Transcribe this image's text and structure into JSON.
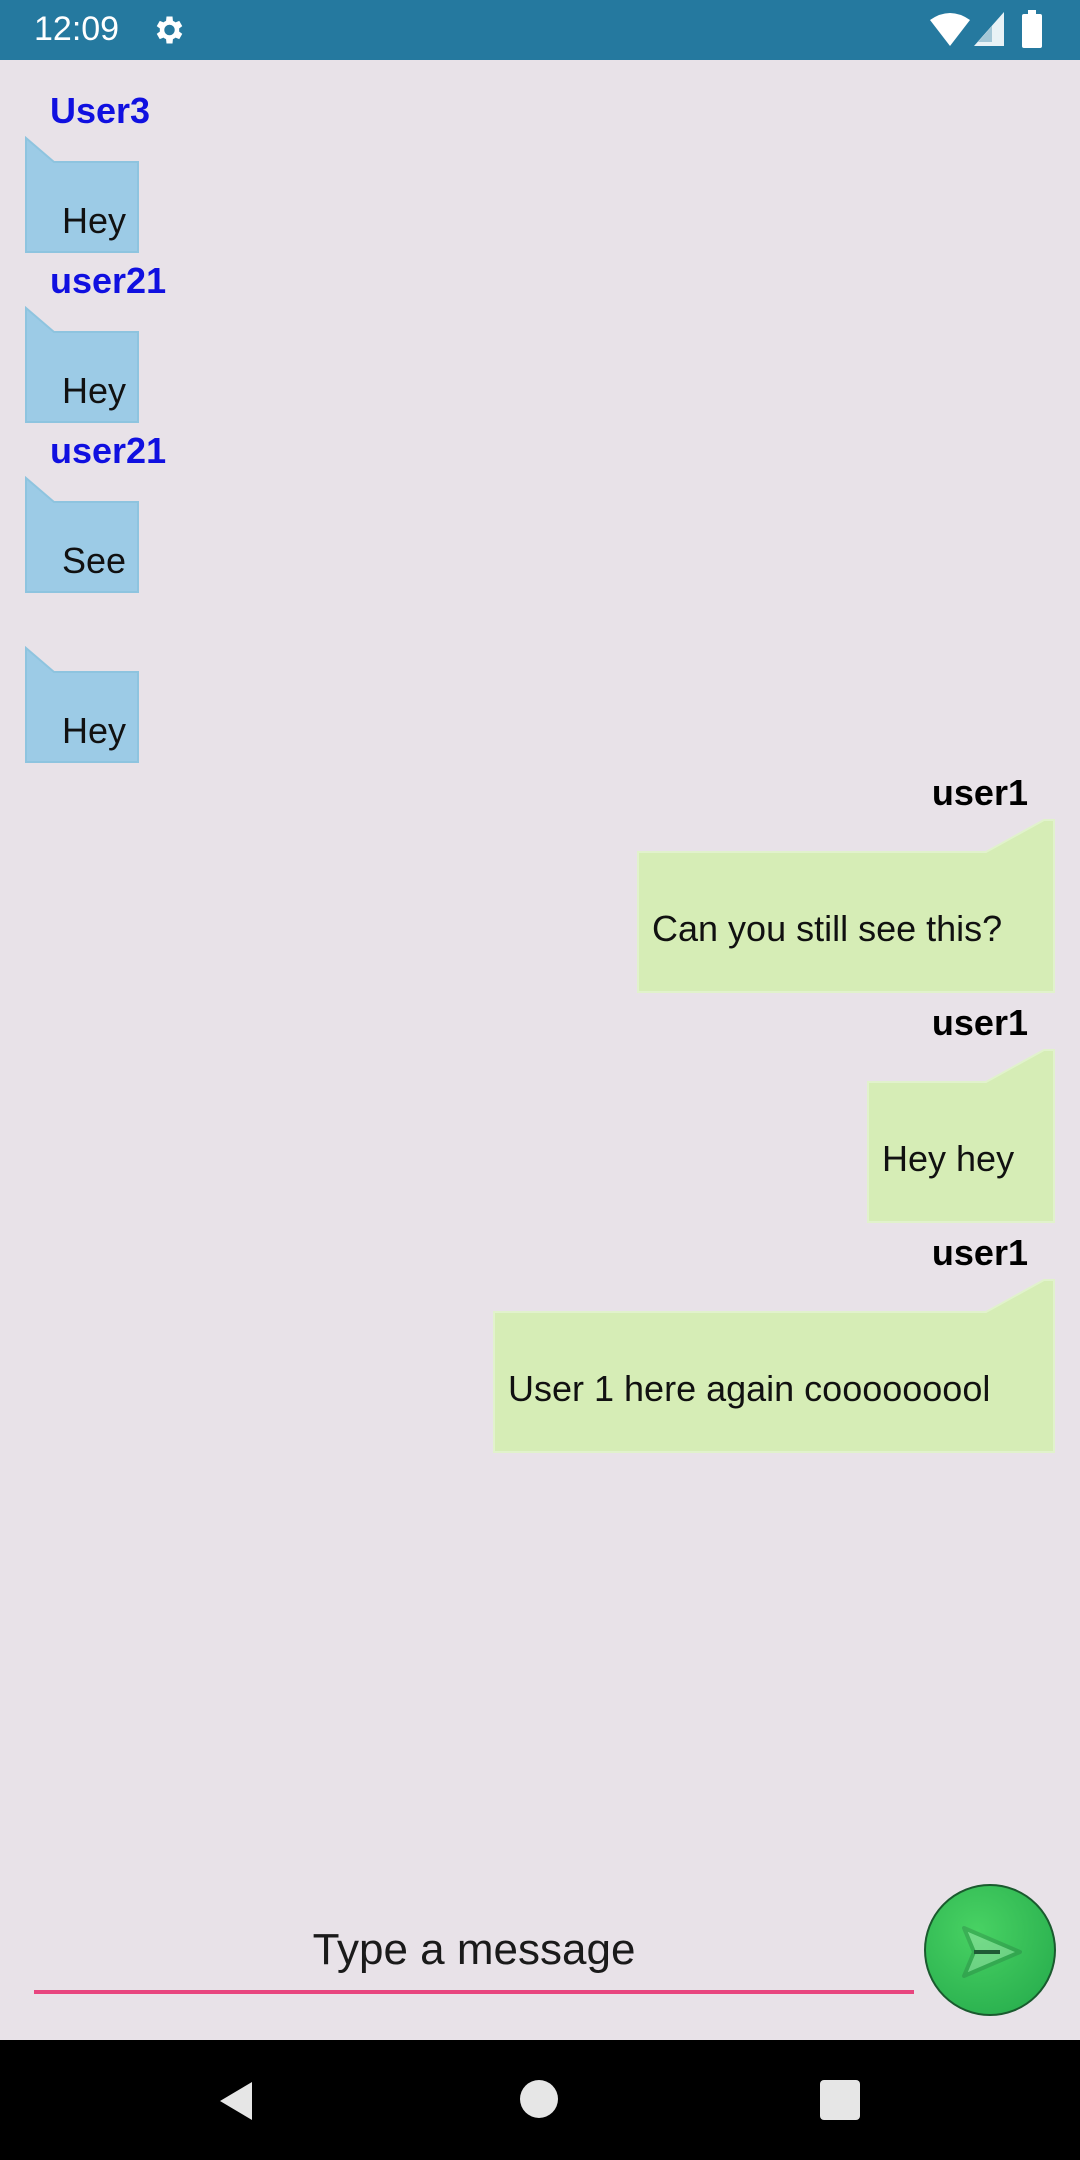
{
  "status_bar": {
    "time": "12:09",
    "background": "#25799f",
    "icons": [
      "gear-icon",
      "wifi-icon",
      "signal-icon",
      "battery-icon"
    ]
  },
  "colors": {
    "incoming_bubble": "#9ccbe6",
    "outgoing_bubble": "#d6edb6",
    "incoming_sender": "#1010e0",
    "outgoing_sender": "#000000",
    "input_underline": "#e8457f",
    "send_button": "#2fbe55"
  },
  "messages": [
    {
      "direction": "incoming",
      "sender": "User3",
      "text": "Hey"
    },
    {
      "direction": "incoming",
      "sender": "user21",
      "text": "Hey"
    },
    {
      "direction": "incoming",
      "sender": "user21",
      "text": "See"
    },
    {
      "direction": "incoming",
      "sender": "",
      "text": "Hey"
    },
    {
      "direction": "outgoing",
      "sender": "user1",
      "text": "Can you still see this?"
    },
    {
      "direction": "outgoing",
      "sender": "user1",
      "text": "Hey hey"
    },
    {
      "direction": "outgoing",
      "sender": "user1",
      "text": "User 1 here again cooooooool"
    }
  ],
  "composer": {
    "placeholder": "Type a message",
    "value": "",
    "send_icon": "send-icon"
  },
  "nav_bar": {
    "icons": [
      "back-icon",
      "home-icon",
      "recents-icon"
    ]
  }
}
